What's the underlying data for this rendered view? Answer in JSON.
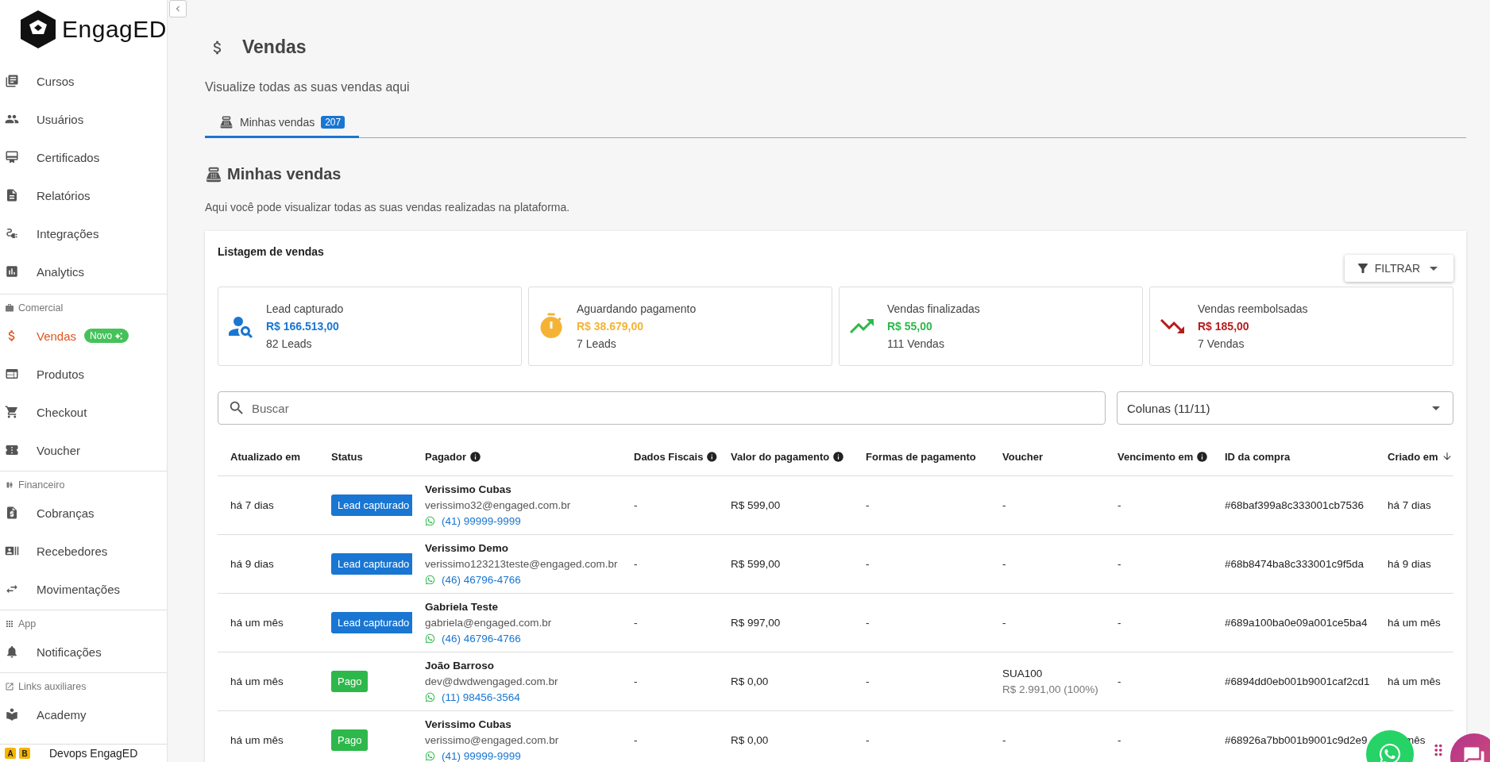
{
  "sidebar": {
    "logo": "EngagED",
    "groups": [
      {
        "items": [
          {
            "label": "Cursos",
            "selected": false
          },
          {
            "label": "Usuários",
            "selected": false
          },
          {
            "label": "Certificados",
            "selected": false
          },
          {
            "label": "Relatórios",
            "selected": false
          },
          {
            "label": "Integrações",
            "selected": false
          },
          {
            "label": "Analytics",
            "selected": false
          }
        ]
      },
      {
        "title": "Comercial",
        "items": [
          {
            "label": "Vendas",
            "selected": true,
            "badge": "Novo"
          },
          {
            "label": "Produtos",
            "selected": false
          },
          {
            "label": "Checkout",
            "selected": false
          },
          {
            "label": "Voucher",
            "selected": false
          }
        ]
      },
      {
        "title": "Financeiro",
        "items": [
          {
            "label": "Cobranças",
            "selected": false
          },
          {
            "label": "Recebedores",
            "selected": false
          },
          {
            "label": "Movimentações",
            "selected": false
          }
        ]
      },
      {
        "title": "App",
        "items": [
          {
            "label": "Notificações",
            "selected": false
          }
        ]
      },
      {
        "title": "Links auxiliares",
        "items": [
          {
            "label": "Academy",
            "selected": false
          }
        ]
      }
    ]
  },
  "env_bar": {
    "badges": [
      "A",
      "B"
    ],
    "label": "Devops EngagED"
  },
  "page": {
    "title": "Vendas",
    "subtitle": "Visualize todas as suas vendas aqui"
  },
  "tabs": [
    {
      "label": "Minhas vendas",
      "count": "207",
      "selected": true
    }
  ],
  "section": {
    "title": "Minhas vendas",
    "description": "Aqui você pode visualizar todas as suas vendas realizadas na plataforma."
  },
  "listing": {
    "title": "Listagem de vendas",
    "filter_button": "FILTRAR",
    "stats": [
      {
        "label": "Lead capturado",
        "amount": "R$ 166.513,00",
        "count": "82 Leads",
        "color": "#1976d2"
      },
      {
        "label": "Aguardando pagamento",
        "amount": "R$ 38.679,00",
        "count": "7 Leads",
        "color": "#f5b335"
      },
      {
        "label": "Vendas finalizadas",
        "amount": "R$ 55,00",
        "count": "111 Vendas",
        "color": "#2eb84b"
      },
      {
        "label": "Vendas reembolsadas",
        "amount": "R$ 185,00",
        "count": "7 Vendas",
        "color": "#b71c1c"
      }
    ],
    "search": {
      "placeholder": "Buscar"
    },
    "columns_select": "Colunas (11/11)"
  },
  "table": {
    "columns": [
      {
        "label": "Atualizado em",
        "info": false,
        "sorted": false
      },
      {
        "label": "Status",
        "info": false,
        "sorted": false
      },
      {
        "label": "Pagador",
        "info": true,
        "sorted": false
      },
      {
        "label": "Dados Fiscais",
        "info": true,
        "sorted": false
      },
      {
        "label": "Valor do pagamento",
        "info": true,
        "sorted": false
      },
      {
        "label": "Formas de pagamento",
        "info": false,
        "sorted": false
      },
      {
        "label": "Voucher",
        "info": false,
        "sorted": false
      },
      {
        "label": "Vencimento em",
        "info": true,
        "sorted": false
      },
      {
        "label": "ID da compra",
        "info": false,
        "sorted": false
      },
      {
        "label": "Criado em",
        "info": false,
        "sorted": true
      }
    ],
    "rows": [
      {
        "updated": "há 7 dias",
        "status": {
          "label": "Lead capturado",
          "kind": "lead"
        },
        "payer": {
          "name": "Verissimo Cubas",
          "email": "verissimo32@engaged.com.br",
          "phone": "(41) 99999-9999"
        },
        "fiscal": "-",
        "value": "R$ 599,00",
        "methods": "-",
        "voucher": "-",
        "due": "-",
        "id": "#68baf399a8c333001cb7536",
        "created": "há 7 dias"
      },
      {
        "updated": "há 9 dias",
        "status": {
          "label": "Lead capturado",
          "kind": "lead"
        },
        "payer": {
          "name": "Verissimo Demo",
          "email": "verissimo123213teste@engaged.com.br",
          "phone": "(46) 46796-4766"
        },
        "fiscal": "-",
        "value": "R$ 599,00",
        "methods": "-",
        "voucher": "-",
        "due": "-",
        "id": "#68b8474ba8c333001c9f5da",
        "created": "há 9 dias"
      },
      {
        "updated": "há um mês",
        "status": {
          "label": "Lead capturado",
          "kind": "lead"
        },
        "payer": {
          "name": "Gabriela Teste",
          "email": "gabriela@engaged.com.br",
          "phone": "(46) 46796-4766"
        },
        "fiscal": "-",
        "value": "R$ 997,00",
        "methods": "-",
        "voucher": "-",
        "due": "-",
        "id": "#689a100ba0e09a001ce5ba4",
        "created": "há um mês"
      },
      {
        "updated": "há um mês",
        "status": {
          "label": "Pago",
          "kind": "paid"
        },
        "payer": {
          "name": "João Barroso",
          "email": "dev@dwdwengaged.com.br",
          "phone": "(11) 98456-3564"
        },
        "fiscal": "-",
        "value": "R$ 0,00",
        "methods": "-",
        "voucher": "SUA100",
        "voucher_detail": "R$ 2.991,00 (100%)",
        "due": "-",
        "id": "#6894dd0eb001b9001caf2cd1",
        "created": "há um mês"
      },
      {
        "updated": "há um mês",
        "status": {
          "label": "Pago",
          "kind": "paid"
        },
        "payer": {
          "name": "Verissimo Cubas",
          "email": "verissimo@engaged.com.br",
          "phone": "(41) 99999-9999"
        },
        "fiscal": "-",
        "value": "R$ 0,00",
        "methods": "-",
        "voucher": "-",
        "due": "-",
        "id": "#68926a7bb001b9001c9d2e9",
        "created": "mês"
      }
    ]
  }
}
